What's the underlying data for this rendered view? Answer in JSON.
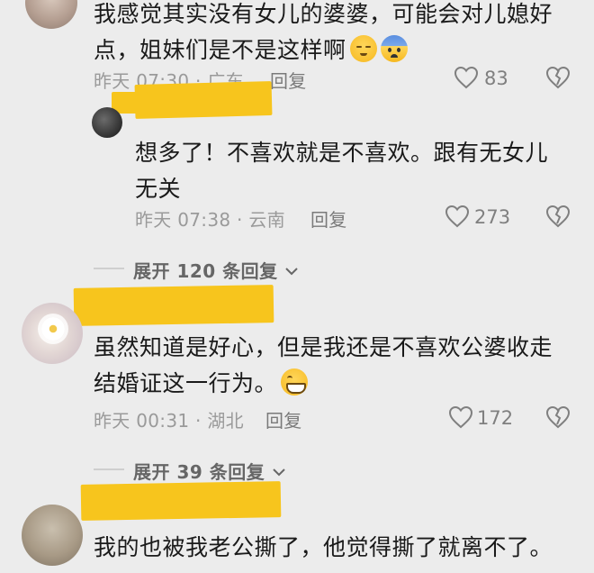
{
  "comments": [
    {
      "text_line1": "我感觉其实没有女儿的婆婆，可能会对儿媳好",
      "text_line2": "点，姐妹们是不是这样啊",
      "emoji1": "sleepy-face-emoji",
      "emoji2": "anxious-face-emoji",
      "time_location": "昨天 07:30 · 广东",
      "reply_label": "回复",
      "likes": "83"
    },
    {
      "text_line1": "想多了！不喜欢就是不喜欢。跟有无女儿",
      "text_line2": "无关",
      "time_location": "昨天 07:38 · 云南",
      "reply_label": "回复",
      "likes": "273"
    },
    {
      "text_line1": "虽然知道是好心，但是我还是不喜欢公婆收走",
      "text_line2": "结婚证这一行为。",
      "emoji1": "grinning-face-emoji",
      "time_location": "昨天 00:31 · 湖北",
      "reply_label": "回复",
      "likes": "172"
    },
    {
      "text_line1": "我的也被我老公撕了，他觉得撕了就离不了。"
    }
  ],
  "expand_replies": [
    {
      "label": "展开 120 条回复"
    },
    {
      "label": "展开 39 条回复"
    }
  ],
  "colors": {
    "background": "#ececec",
    "highlight": "#f7c51d",
    "meta_text": "#9a9a9a"
  }
}
